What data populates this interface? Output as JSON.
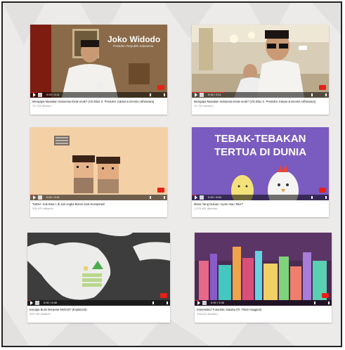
{
  "videos": [
    {
      "title": "Mengapa Masakan Indonesia Enak enak? (Vlo Bloo X. Presiden Jokowi & Dennis Adhiswara)",
      "views": "70.723 ditonton",
      "time": "0:00 / 3:11",
      "overlay_name": "Joko Widodo",
      "overlay_sub": "Presiden Republik Indonesia",
      "progress": 0.05
    },
    {
      "title": "Mengapa Masakan Indonesia Enak enak? (Vlo Bloo X. Presiden Jokowi & Dennis Adhiswara)",
      "views": "70.723 ditonton",
      "time": "0:45 / 3:11",
      "progress": 0.24
    },
    {
      "title": "Twitter: Kok Bisa c.Ib Jati Angka Bisnis Soal Konspirasi!",
      "views": "200.970 ditonton",
      "time": "0:00 / 3:01",
      "progress": 0.02
    },
    {
      "title": "Mana Yang Duluan: Ayam Atau Telur?",
      "views": "1.370.461 ditonton",
      "time": "0:00 / 3:54",
      "overlay_line1": "TEBAK-TEBAKAN",
      "overlay_line2": "TERTUA DI DUNIA",
      "progress": 0.03
    },
    {
      "title": "Kenapa Bumi Berputar Melintir? (Explained)",
      "views": "325.746 ditonton",
      "time": "0:00 / 4:08",
      "progress": 0.02
    },
    {
      "title": "Interessted: Futuristic Jakarta (Ft. Tirtan Haggest)",
      "views": "298.611 ditonton",
      "time": "0:00 / 3:36",
      "progress": 0.03
    }
  ],
  "colors": {
    "frame_bg": "#ecebea",
    "progress": "#dd2222",
    "youtube_red": "#e62117",
    "purple": "#7a5bbf"
  }
}
